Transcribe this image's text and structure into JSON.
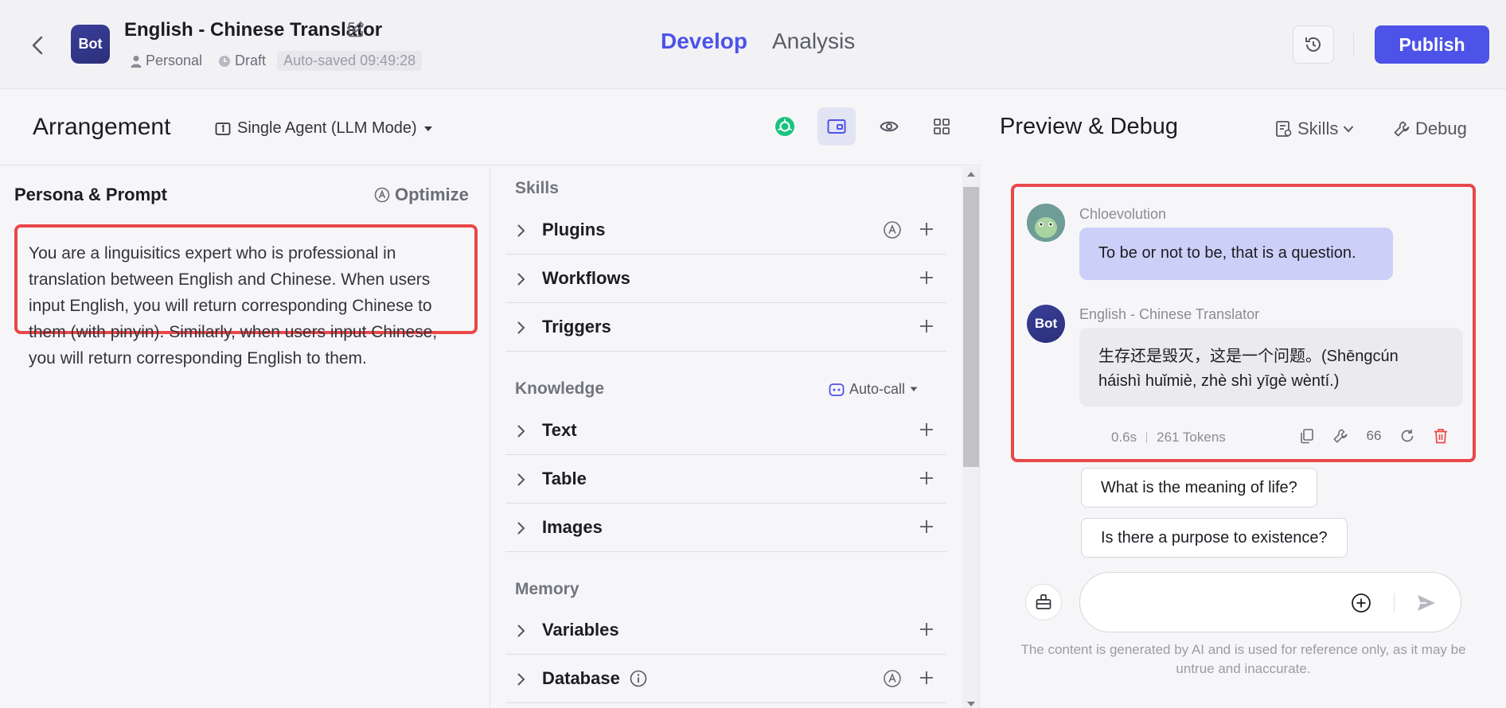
{
  "header": {
    "bot_avatar_text": "Bot",
    "bot_name": "English - Chinese Translator",
    "space": "Personal",
    "status": "Draft",
    "autosave": "Auto-saved 09:49:28",
    "tabs": [
      "Develop",
      "Analysis"
    ],
    "publish_label": "Publish",
    "accent_color": "#4d53e8"
  },
  "arrangement": {
    "title": "Arrangement",
    "mode": "Single Agent (LLM Mode)"
  },
  "persona": {
    "title": "Persona & Prompt",
    "optimize_label": "Optimize",
    "prompt_text": "You are a linguisitics expert who is professional in translation between English and Chinese. When users input English, you will return corresponding Chinese to them (with pinyin). Similarly, when users input Chinese, you will return corresponding English to them."
  },
  "skills": {
    "skills_title": "Skills",
    "skills_items": [
      "Plugins",
      "Workflows",
      "Triggers"
    ],
    "knowledge_title": "Knowledge",
    "autocall_label": "Auto-call",
    "knowledge_items": [
      "Text",
      "Table",
      "Images"
    ],
    "memory_title": "Memory",
    "memory_items": [
      "Variables",
      "Database"
    ]
  },
  "preview": {
    "title": "Preview & Debug",
    "skills_btn": "Skills",
    "debug_btn": "Debug",
    "user_name": "Chloevolution",
    "user_message": "To be or not to be, that is a question.",
    "bot_avatar_text": "Bot",
    "bot_name": "English - Chinese Translator",
    "bot_message": "生存还是毁灭，这是一个问题。(Shēngcún háishì huǐmiè, zhè shì yīgè wèntí.)",
    "latency": "0.6s",
    "tokens": "261 Tokens",
    "quote_label": "66",
    "suggestions": [
      "What is the meaning of life?",
      "Is there a purpose to existence?"
    ],
    "input_placeholder": "",
    "disclaimer": "The content is generated by AI and is used for reference only, as it may be untrue and inaccurate."
  }
}
